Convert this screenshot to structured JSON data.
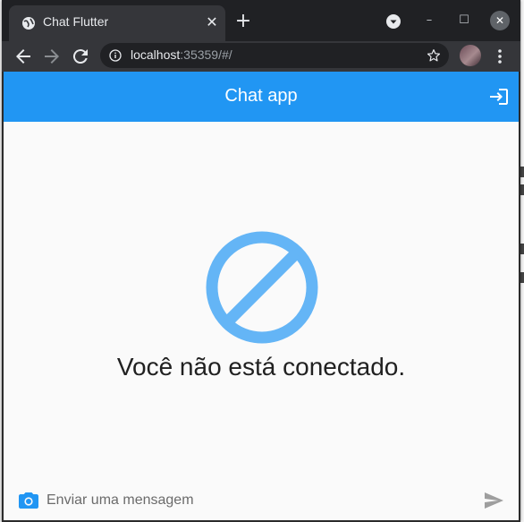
{
  "browser": {
    "tab_title": "Chat Flutter",
    "tab_close_glyph": "✕",
    "new_tab_glyph": "+",
    "url_host": "localhost",
    "url_rest": ":35359/#/",
    "window_controls": {
      "minimize_glyph": "–",
      "maximize_glyph": "☐",
      "close_glyph": "✕"
    },
    "icons": [
      "globe-icon",
      "tab-search-icon",
      "back-icon",
      "forward-icon",
      "reload-icon",
      "info-icon",
      "star-icon",
      "profile-avatar",
      "menu-icon"
    ]
  },
  "app": {
    "title": "Chat app",
    "status_message": "Você não está conectado.",
    "composer": {
      "placeholder": "Enviar uma mensagem",
      "value": ""
    },
    "icons": [
      "login-icon",
      "block-icon",
      "camera-icon",
      "send-icon"
    ],
    "colors": {
      "primary": "#2196f3",
      "block_icon": "#64b5f6",
      "background": "#fafafa"
    }
  }
}
